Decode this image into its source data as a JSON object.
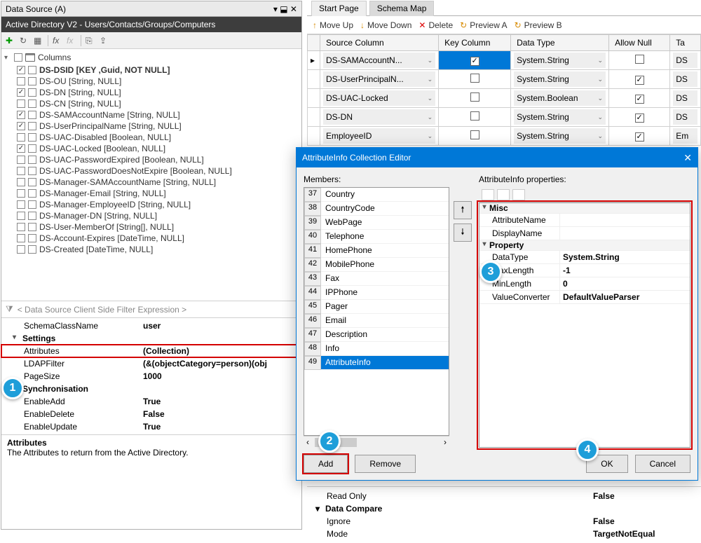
{
  "left": {
    "title": "Data Source (A)",
    "subtitle": "Active Directory V2 - Users/Contacts/Groups/Computers",
    "root_label": "Columns",
    "columns": [
      {
        "label": "DS-DSID [KEY ,Guid, NOT NULL]",
        "checked": true,
        "bold": true
      },
      {
        "label": "DS-OU [String, NULL]",
        "checked": false
      },
      {
        "label": "DS-DN [String, NULL]",
        "checked": true
      },
      {
        "label": "DS-CN [String, NULL]",
        "checked": false
      },
      {
        "label": "DS-SAMAccountName [String, NULL]",
        "checked": true
      },
      {
        "label": "DS-UserPrincipalName [String, NULL]",
        "checked": true
      },
      {
        "label": "DS-UAC-Disabled [Boolean, NULL]",
        "checked": false
      },
      {
        "label": "DS-UAC-Locked [Boolean, NULL]",
        "checked": true
      },
      {
        "label": "DS-UAC-PasswordExpired [Boolean, NULL]",
        "checked": false
      },
      {
        "label": "DS-UAC-PasswordDoesNotExpire [Boolean, NULL]",
        "checked": false
      },
      {
        "label": "DS-Manager-SAMAccountName [String, NULL]",
        "checked": false
      },
      {
        "label": "DS-Manager-Email [String, NULL]",
        "checked": false
      },
      {
        "label": "DS-Manager-EmployeeID [String, NULL]",
        "checked": false
      },
      {
        "label": "DS-Manager-DN [String, NULL]",
        "checked": false
      },
      {
        "label": "DS-User-MemberOf [String[], NULL]",
        "checked": false
      },
      {
        "label": "DS-Account-Expires [DateTime, NULL]",
        "checked": false
      },
      {
        "label": "DS-Created [DateTime, NULL]",
        "checked": false
      }
    ],
    "filter_placeholder": "< Data Source Client Side Filter Expression >",
    "props": {
      "schemaClassName_label": "SchemaClassName",
      "schemaClassName_value": "user",
      "cat_settings": "Settings",
      "attributes_label": "Attributes",
      "attributes_value": "(Collection)",
      "ldapFilter_label": "LDAPFilter",
      "ldapFilter_value": "(&(objectCategory=person)(obj",
      "pageSize_label": "PageSize",
      "pageSize_value": "1000",
      "cat_sync": "Synchronisation",
      "enableAdd_label": "EnableAdd",
      "enableAdd_value": "True",
      "enableDelete_label": "EnableDelete",
      "enableDelete_value": "False",
      "enableUpdate_label": "EnableUpdate",
      "enableUpdate_value": "True"
    },
    "desc_title": "Attributes",
    "desc_text": "The Attributes to return from the Active Directory."
  },
  "right": {
    "tab1": "Start Page",
    "tab2": "Schema Map",
    "tb": {
      "moveUp": "Move Up",
      "moveDown": "Move Down",
      "delete": "Delete",
      "previewA": "Preview A",
      "previewB": "Preview B"
    },
    "headers": {
      "source": "Source Column",
      "key": "Key Column",
      "datatype": "Data Type",
      "allowNull": "Allow Null",
      "ta": "Ta"
    },
    "rows": [
      {
        "source": "DS-SAMAccountN...",
        "key": true,
        "keySel": true,
        "type": "System.String",
        "allowNull": false,
        "last": "DS"
      },
      {
        "source": "DS-UserPrincipalN...",
        "key": false,
        "type": "System.String",
        "allowNull": true,
        "last": "DS"
      },
      {
        "source": "DS-UAC-Locked",
        "key": false,
        "type": "System.Boolean",
        "allowNull": true,
        "last": "DS"
      },
      {
        "source": "DS-DN",
        "key": false,
        "type": "System.String",
        "allowNull": true,
        "last": "DS"
      },
      {
        "source": "EmployeeID",
        "key": false,
        "type": "System.String",
        "allowNull": true,
        "last": "Em"
      }
    ],
    "lower": {
      "readonly_label": "Read Only",
      "readonly_value": "False",
      "cat_compare": "Data Compare",
      "ignore_label": "Ignore",
      "ignore_value": "False",
      "mode_label": "Mode",
      "mode_value": "TargetNotEqual"
    }
  },
  "dialog": {
    "title": "AttributeInfo Collection Editor",
    "members_label": "Members:",
    "props_label": "AttributeInfo properties:",
    "members": [
      {
        "n": "37",
        "name": "Country"
      },
      {
        "n": "38",
        "name": "CountryCode"
      },
      {
        "n": "39",
        "name": "WebPage"
      },
      {
        "n": "40",
        "name": "Telephone"
      },
      {
        "n": "41",
        "name": "HomePhone"
      },
      {
        "n": "42",
        "name": "MobilePhone"
      },
      {
        "n": "43",
        "name": "Fax"
      },
      {
        "n": "44",
        "name": "IPPhone"
      },
      {
        "n": "45",
        "name": "Pager"
      },
      {
        "n": "46",
        "name": "Email"
      },
      {
        "n": "47",
        "name": "Description"
      },
      {
        "n": "48",
        "name": "Info"
      },
      {
        "n": "49",
        "name": "AttributeInfo",
        "selected": true
      }
    ],
    "add": "Add",
    "remove": "Remove",
    "ok": "OK",
    "cancel": "Cancel",
    "pg": {
      "cat_misc": "Misc",
      "attrName_label": "AttributeName",
      "attrName_value": "",
      "dispName_label": "DisplayName",
      "dispName_value": "",
      "cat_prop": "Property",
      "dataType_label": "DataType",
      "dataType_value": "System.String",
      "maxLen_label": "MaxLength",
      "maxLen_value": "-1",
      "minLen_label": "MinLength",
      "minLen_value": "0",
      "valConv_label": "ValueConverter",
      "valConv_value": "DefaultValueParser"
    }
  }
}
